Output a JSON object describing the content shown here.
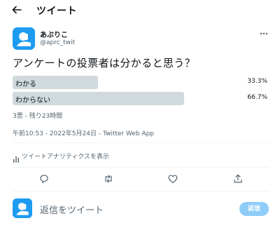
{
  "header": {
    "title": "ツイート"
  },
  "tweet": {
    "display_name": "あぶりこ",
    "handle": "@aprc_twit",
    "text": "アンケートの投票者は分かると思う？",
    "poll": {
      "options": [
        {
          "label": "わかる",
          "percent_label": "33.3%",
          "percent": 33.3
        },
        {
          "label": "わからない",
          "percent_label": "66.7%",
          "percent": 66.7
        }
      ],
      "meta": "3票 - 残り23時間"
    },
    "timestamp": "午前10:53 - 2022年5月24日 - Twitter Web App",
    "analytics_label": "ツイートアナリティクスを表示"
  },
  "actions": [
    "reply-icon",
    "retweet-icon",
    "like-icon",
    "share-icon"
  ],
  "reply_box": {
    "placeholder": "返信をツイート",
    "button_label": "返信"
  },
  "colors": {
    "accent": "#1d9bf0",
    "reply_button_disabled": "#8ecdf8",
    "poll_bar": "#cfd9de",
    "secondary_text": "#536471"
  }
}
